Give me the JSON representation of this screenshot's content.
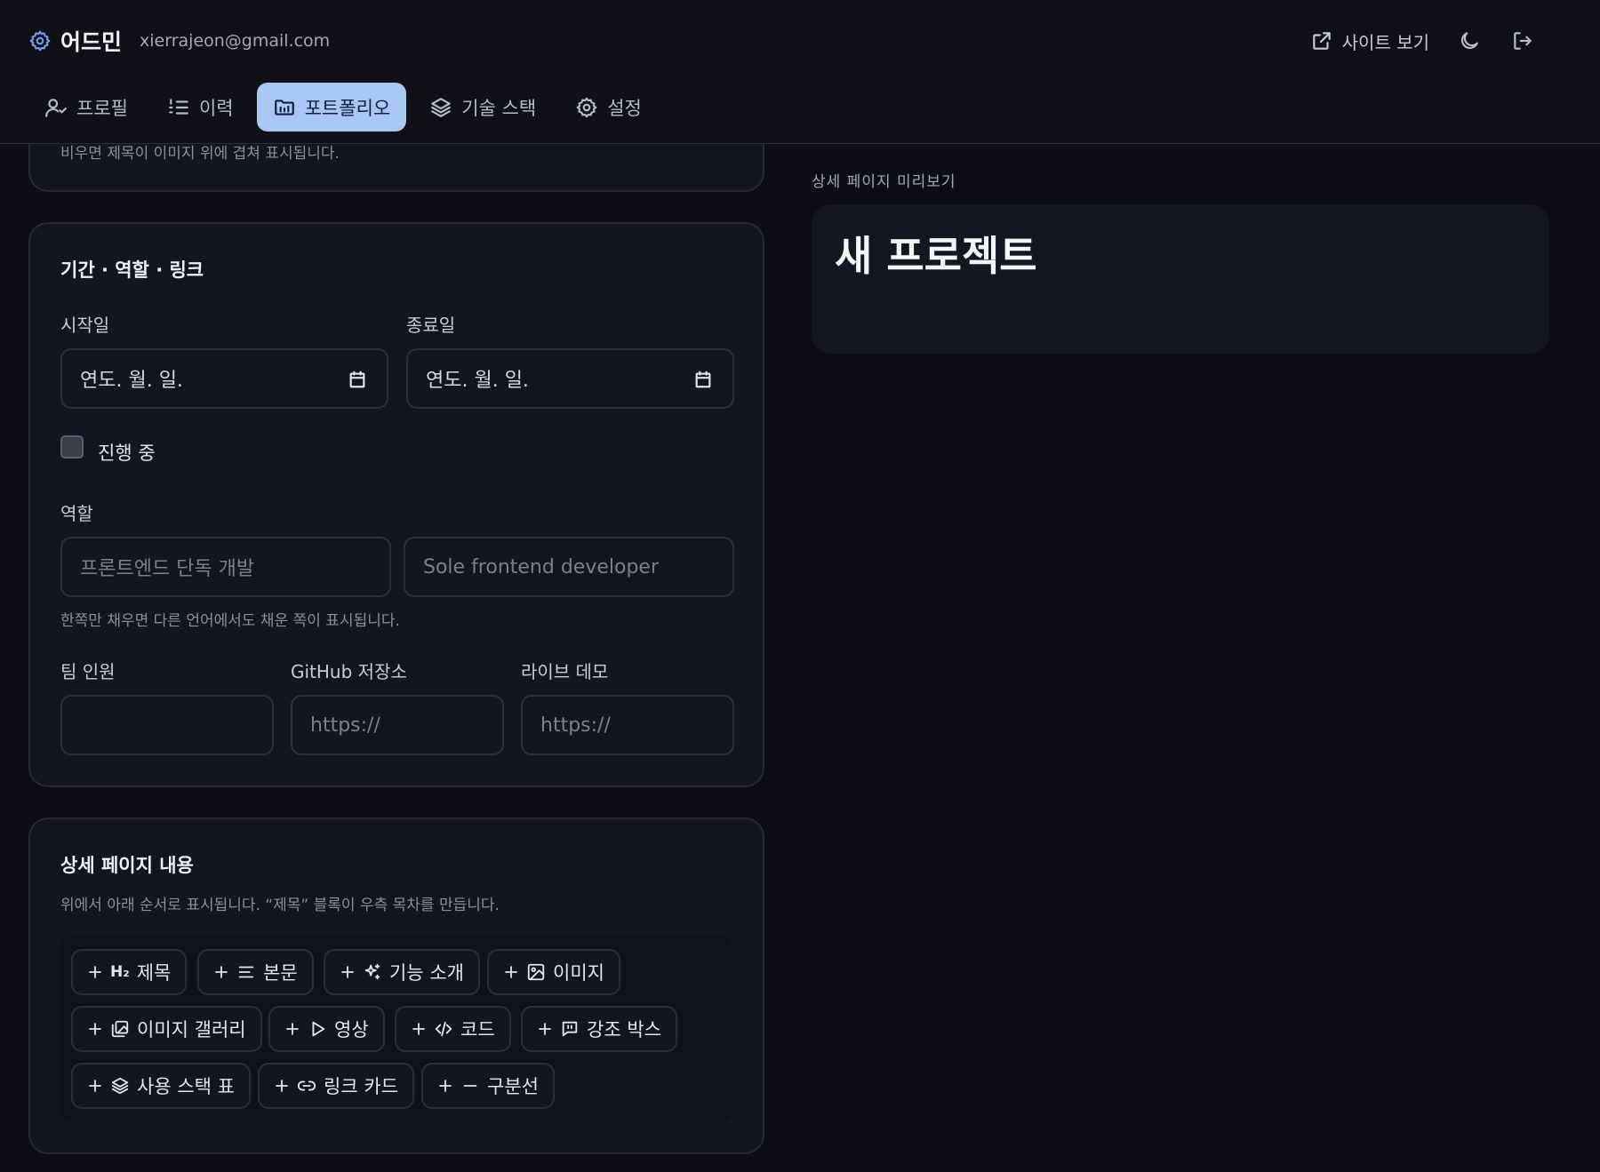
{
  "header": {
    "title": "어드민",
    "email": "xierrajeon@gmail.com",
    "site_link_label": "사이트 보기"
  },
  "tabs": [
    {
      "label": "프로필",
      "icon": "user-icon",
      "active": false
    },
    {
      "label": "이력",
      "icon": "list-icon",
      "active": false
    },
    {
      "label": "포트폴리오",
      "icon": "folder-icon",
      "active": true
    },
    {
      "label": "기술 스택",
      "icon": "layers-icon",
      "active": false
    },
    {
      "label": "설정",
      "icon": "gear-icon",
      "active": false
    }
  ],
  "top_card": {
    "partial_text": "비우면 제목이 이미지 위에 겹쳐 표시됩니다."
  },
  "period_card": {
    "title": "기간 · 역할 · 링크",
    "start_label": "시작일",
    "end_label": "종료일",
    "date_placeholder": "연도. 월. 일.",
    "in_progress_label": "진행 중",
    "in_progress_checked": false,
    "role_label": "역할",
    "role_ko_placeholder": "프론트엔드 단독 개발",
    "role_en_placeholder": "Sole frontend developer",
    "role_hint": "한쪽만 채우면 다른 언어에서도 채운 쪽이 표시됩니다.",
    "team_label": "팀 인원",
    "team_value": "",
    "github_label": "GitHub 저장소",
    "github_placeholder": "https://",
    "demo_label": "라이브 데모",
    "demo_placeholder": "https://"
  },
  "detail_card": {
    "title": "상세 페이지 내용",
    "hint": "위에서 아래 순서로 표시됩니다. “제목” 블록이 우측 목차를 만듭니다.",
    "blocks": [
      {
        "label": "제목",
        "icon": "heading-icon"
      },
      {
        "label": "본문",
        "icon": "text-lines-icon"
      },
      {
        "label": "기능 소개",
        "icon": "sparkles-icon"
      },
      {
        "label": "이미지",
        "icon": "image-icon"
      },
      {
        "label": "이미지 갤러리",
        "icon": "gallery-icon"
      },
      {
        "label": "영상",
        "icon": "play-icon"
      },
      {
        "label": "코드",
        "icon": "code-icon"
      },
      {
        "label": "강조 박스",
        "icon": "callout-icon"
      },
      {
        "label": "사용 스택 표",
        "icon": "layers-icon"
      },
      {
        "label": "링크 카드",
        "icon": "link-icon"
      },
      {
        "label": "구분선",
        "icon": "minus-icon"
      }
    ]
  },
  "preview": {
    "label": "상세 페이지 미리보기",
    "title": "새 프로젝트"
  },
  "colors": {
    "background": "#0c0e14",
    "card": "#131620",
    "accent_tab": "#a9c7f5",
    "brand_icon": "#6f9cf0"
  }
}
